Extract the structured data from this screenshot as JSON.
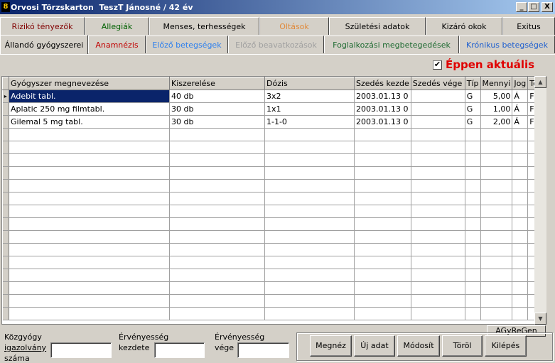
{
  "window": {
    "title": "Orvosi Törzskarton  TeszT Jánosné / 42 év",
    "min_label": "_",
    "max_label": "□",
    "close_label": "X"
  },
  "tabs_top": [
    {
      "label": "Rizikó tényezők",
      "color": "#800000"
    },
    {
      "label": "Allegiák",
      "color": "#006000"
    },
    {
      "label": "Menses, terhességek",
      "color": "#000000"
    },
    {
      "label": "Oltások",
      "color": "#e08a3c"
    },
    {
      "label": "Születési adatok",
      "color": "#000000"
    },
    {
      "label": "Kizáró okok",
      "color": "#000000"
    },
    {
      "label": "Exitus",
      "color": "#000000"
    }
  ],
  "tabs_bottom": [
    {
      "label": "Állandó gyógyszerei",
      "color": "#000000",
      "active": true
    },
    {
      "label": "Anamnézis",
      "color": "#c00000"
    },
    {
      "label": "Előző betegségek",
      "color": "#2f80ed"
    },
    {
      "label": "Előző beavatkozások",
      "color": "#a0a0a0"
    },
    {
      "label": "Foglalkozási megbetegedések",
      "color": "#1f6b32"
    },
    {
      "label": "Krónikus betegségek",
      "color": "#1e5fcf"
    }
  ],
  "filter": {
    "checked_mark": "✔",
    "label": "Éppen aktuális"
  },
  "grid": {
    "columns": [
      "Gyógyszer megnevezése",
      "Kiszerelése",
      "Dózis",
      "Szedés kezde",
      "Szedés vége",
      "Típ",
      "Mennyi",
      "Jog",
      "Te"
    ],
    "rows": [
      [
        "Adebit tabl.",
        "40 db",
        "3x2",
        "2003.01.13 0",
        "",
        "G",
        "5,00",
        "Á",
        "F"
      ],
      [
        "Aplatic 250 mg filmtabl.",
        "30 db",
        "1x1",
        "2003.01.13 0",
        "",
        "G",
        "1,00",
        "Á",
        "F"
      ],
      [
        "Gilemal 5 mg tabl.",
        "30 db",
        "1-1-0",
        "2003.01.13 0",
        "",
        "G",
        "2,00",
        "Á",
        "F"
      ]
    ],
    "selected_row": 0,
    "row_pointer": "▸"
  },
  "scrollbar": {
    "up": "▲",
    "down": "▼"
  },
  "fields": {
    "kozgyogy_line1": "Közgyógy",
    "kozgyogy_line2": "igazolvány",
    "kozgyogy_line3": "száma",
    "ervkezd_line1": "Érvényesség",
    "ervkezd_line2": "kezdete",
    "ervvege_line1": "Érvényesség",
    "ervvege_line2": "vége",
    "kozgyogy_value": "",
    "ervkezd_value": "",
    "ervvege_value": ""
  },
  "buttons": {
    "agy": "AGyReGen",
    "megnez": "Megnéz",
    "uj": "Új adat",
    "modosit": "Módosít",
    "torol": "Töröl",
    "kilepes": "Kilépés"
  }
}
